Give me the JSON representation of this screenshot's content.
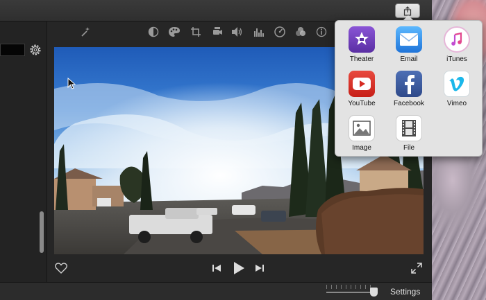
{
  "share_menu": {
    "items": [
      {
        "label": "Theater",
        "icon": "theater-icon",
        "color": "#6a3fb5"
      },
      {
        "label": "Email",
        "icon": "email-icon",
        "color": "#2d8ee8"
      },
      {
        "label": "iTunes",
        "icon": "itunes-icon",
        "color": "#ffffff"
      },
      {
        "label": "YouTube",
        "icon": "youtube-icon",
        "color": "#d62b22"
      },
      {
        "label": "Facebook",
        "icon": "facebook-icon",
        "color": "#3b5998"
      },
      {
        "label": "Vimeo",
        "icon": "vimeo-icon",
        "color": "#1ab7ea"
      },
      {
        "label": "Image",
        "icon": "image-icon",
        "color": "#ffffff"
      },
      {
        "label": "File",
        "icon": "file-icon",
        "color": "#ffffff"
      }
    ]
  },
  "toolbar": {
    "tools": [
      "magic-wand-icon",
      "color-balance-icon",
      "color-palette-icon",
      "crop-icon",
      "stabilization-icon",
      "volume-icon",
      "equalizer-icon",
      "speed-icon",
      "filter-icon",
      "info-icon"
    ]
  },
  "bottom_bar": {
    "settings_label": "Settings"
  }
}
